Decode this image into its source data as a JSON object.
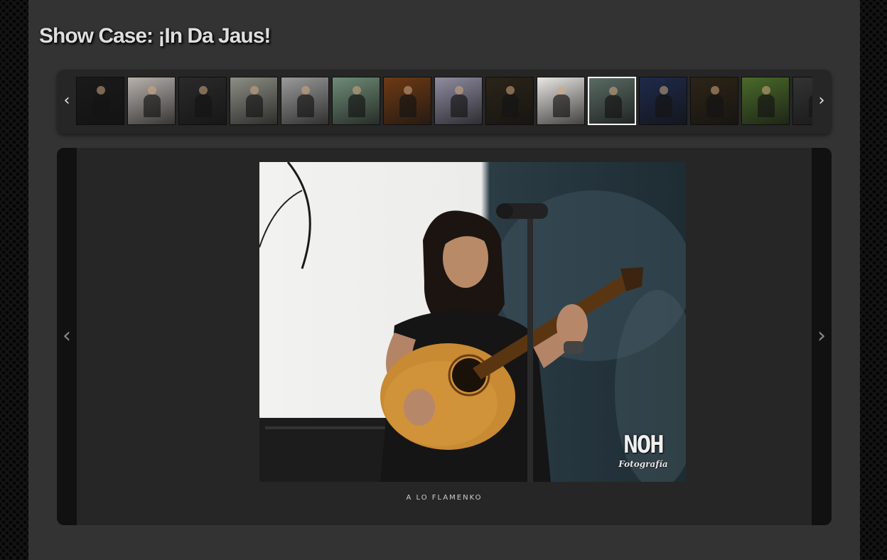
{
  "page": {
    "title": "Show Case: ¡In Da Jaus!"
  },
  "thumbnails": {
    "prev_icon": "chevron-left-icon",
    "next_icon": "chevron-right-icon",
    "prev_glyph": "‹",
    "next_glyph": "›",
    "active_index": 10,
    "items": [
      {
        "tone": "#1a1a1a"
      },
      {
        "tone": "#b8b2ad"
      },
      {
        "tone": "#2a2a2a"
      },
      {
        "tone": "#8d8e85"
      },
      {
        "tone": "#9a9a9a"
      },
      {
        "tone": "#6f8c77"
      },
      {
        "tone": "#6e3a15"
      },
      {
        "tone": "#8f8ca0"
      },
      {
        "tone": "#2b2418"
      },
      {
        "tone": "#e9e6e3"
      },
      {
        "tone": "#5a6a63"
      },
      {
        "tone": "#1f2a4a"
      },
      {
        "tone": "#2d2416"
      },
      {
        "tone": "#4a6a2a"
      },
      {
        "tone": "#333333"
      }
    ]
  },
  "viewer": {
    "prev_glyph": "‹",
    "next_glyph": "›",
    "caption": "A LO FLAMENKO",
    "watermark": {
      "logo": "NOH",
      "sub": "Fotografía"
    }
  }
}
